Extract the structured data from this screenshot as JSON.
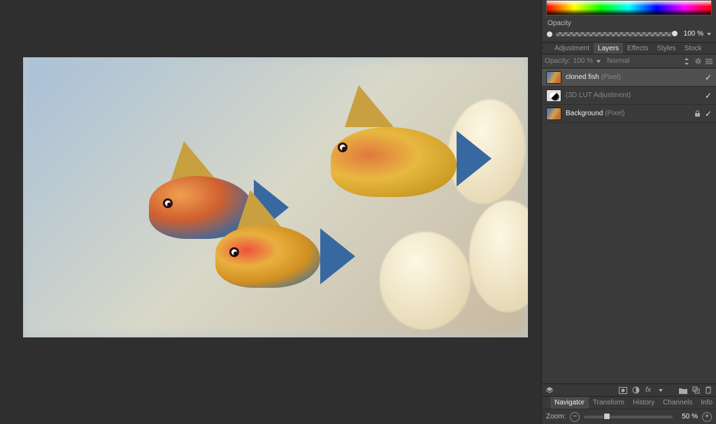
{
  "color_panel": {
    "opacity_label": "Opacity",
    "opacity_value": "100 %"
  },
  "panel_tabs": {
    "adjustment": "Adjustment",
    "layers": "Layers",
    "effects": "Effects",
    "styles": "Styles",
    "stock": "Stock"
  },
  "layer_options": {
    "opacity_label": "Opacity:",
    "opacity_value": "100 %",
    "blend_mode": "Normal"
  },
  "layers": [
    {
      "name": "cloned fish",
      "kind": "(Pixel)",
      "locked": false,
      "visible": true
    },
    {
      "name": "(3D LUT Adjustment)",
      "kind": "",
      "locked": false,
      "visible": true
    },
    {
      "name": "Background",
      "kind": "(Pixel)",
      "locked": true,
      "visible": true
    }
  ],
  "nav_tabs": {
    "navigator": "Navigator",
    "transform": "Transform",
    "history": "History",
    "channels": "Channels",
    "info": "Info"
  },
  "navigator": {
    "zoom_label": "Zoom:",
    "zoom_value": "50 %",
    "zoom_handle_percent": 22
  }
}
